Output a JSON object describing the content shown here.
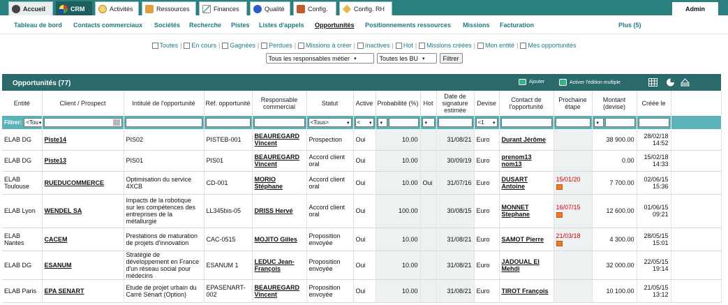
{
  "top_tabs": [
    "Accueil",
    "CRM",
    "Activités",
    "Ressources",
    "Finances",
    "Qualité",
    "Config.",
    "Config. RH"
  ],
  "admin": "Admin",
  "subnav": [
    "Tableau de bord",
    "Contacts commerciaux",
    "Sociétés",
    "Recherche",
    "Pistes",
    "Listes d'appels",
    "Opportunités",
    "Positionnements ressources",
    "Missions",
    "Facturation",
    "Plus (5)"
  ],
  "filters": [
    "Toutes",
    "En cours",
    "Gagnées",
    "Perdues",
    "Missions à créer",
    "Inactives",
    "Hot",
    "Missions créées",
    "Mon entité",
    "Mes opportunités"
  ],
  "select_responsables": "Tous les responsables métier",
  "select_bu": "Toutes les BU",
  "filter_button": "Filtrer",
  "panel": {
    "title": "Opportunités (77)",
    "add": "Ajouter",
    "edit": "Activer l'édition multiple"
  },
  "columns": [
    "Entité",
    "Client / Prospect",
    "Intitulé de l'opportunité",
    "Réf. opportunité",
    "Responsable commercial",
    "Statut",
    "Active",
    "Probabilité (%)",
    "Hot",
    "Date de signature estimée",
    "Devise",
    "Contact de l'opportunité",
    "Prochaine étape",
    "Montant (devise)",
    "Créée le"
  ],
  "filter_row": {
    "label": "Filtrer:",
    "entite": "<Tou",
    "statut": "<Tous>",
    "devise": "<1"
  },
  "rows": [
    {
      "entite": "ELAB DG",
      "client": "Piste14",
      "intitule": "PIS02",
      "ref": "PISTEB-001",
      "resp": "BEAUREGARD Vincent",
      "statut": "Prospection",
      "active": "Oui",
      "proba": "10.00",
      "hot": "",
      "date": "31/08/21",
      "devise": "Euro",
      "contact": "Durant Jérôme",
      "etape": "",
      "montant": "38 900.00",
      "cree": "28/02/18 14:52"
    },
    {
      "entite": "ELAB DG",
      "client": "Piste13",
      "intitule": "PIS01",
      "ref": "PIS01",
      "resp": "BEAUREGARD Vincent",
      "statut": "Accord client oral",
      "active": "Oui",
      "proba": "10.00",
      "hot": "",
      "date": "30/09/19",
      "devise": "Euro",
      "contact": "prenom13 nom13",
      "etape": "",
      "montant": "0.00",
      "cree": "15/02/18 14:33"
    },
    {
      "entite": "ELAB Toulouse",
      "client": "RUEDUCOMMERCE",
      "intitule": "Optimisation du service 4XCB",
      "ref": "CD-001",
      "resp": "MORIO Stéphane",
      "statut": "Accord client oral",
      "active": "Oui",
      "proba": "10.00",
      "hot": "Oui",
      "date": "31/07/16",
      "devise": "Euro",
      "contact": "DUSART Antoine",
      "etape": "15/01/20",
      "montant": "7 700.00",
      "cree": "02/06/15 15:36"
    },
    {
      "entite": "ELAB Lyon",
      "client": "WENDEL SA",
      "intitule": "Impacts de la robotique sur les compétences des entreprises de la métallurgie",
      "ref": "LL345bis-05",
      "resp": "DRISS Hervé",
      "statut": "Accord client oral",
      "active": "Oui",
      "proba": "100.00",
      "hot": "",
      "date": "30/08/15",
      "devise": "Euro",
      "contact": "MONNET Stephane",
      "etape": "16/07/15",
      "montant": "12 600.00",
      "cree": "01/06/15 09:21"
    },
    {
      "entite": "ELAB Nantes",
      "client": "CACEM",
      "intitule": "Prestations de maturation de projets d'innovation",
      "ref": "CAC-0515",
      "resp": "MOJITO Gilles",
      "statut": "Proposition envoyée",
      "active": "Oui",
      "proba": "10.00",
      "hot": "",
      "date": "31/08/21",
      "devise": "Euro",
      "contact": "SAMOT Pierre",
      "etape": "21/03/18",
      "montant": "4 300.00",
      "cree": "28/05/15 15:01"
    },
    {
      "entite": "ELAB DG",
      "client": "ESANUM",
      "intitule": "Stratégie de développement en France d'un réseau social pour médecins",
      "ref": "ESANUM 1",
      "resp": "LEDUC Jean-François",
      "statut": "Proposition envoyée",
      "active": "Oui",
      "proba": "10.00",
      "hot": "",
      "date": "31/08/21",
      "devise": "Euro",
      "contact": "JADOUAL El Mehdi",
      "etape": "",
      "montant": "32 000.00",
      "cree": "22/05/15 19:14"
    },
    {
      "entite": "ELAB Paris",
      "client": "EPA SENART",
      "intitule": "Etude de projet urbain du Carré Sénart (Option)",
      "ref": "EPASENART-002",
      "resp": "BEAUREGARD Vincent",
      "statut": "Proposition envoyée",
      "active": "Oui",
      "proba": "10.00",
      "hot": "",
      "date": "31/08/21",
      "devise": "Euro",
      "contact": "TIROT François",
      "etape": "",
      "montant": "10 100.00",
      "cree": "21/05/15 13:12"
    }
  ]
}
